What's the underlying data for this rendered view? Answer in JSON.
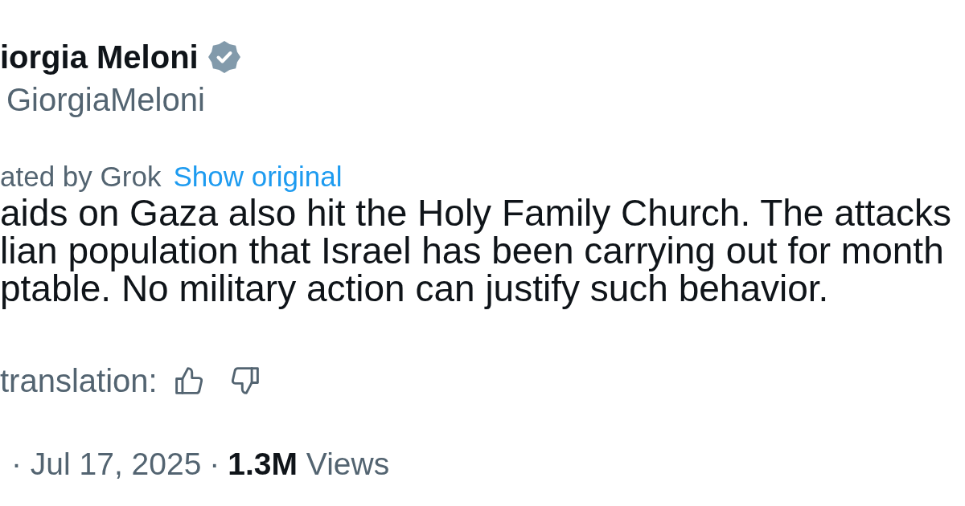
{
  "author": {
    "name": "iorgia Meloni",
    "verified": true,
    "handle": "GiorgiaMeloni"
  },
  "translation": {
    "label": "ated by Grok",
    "link": "Show original"
  },
  "body_lines": [
    "aids on Gaza also hit the Holy Family Church. The attacks",
    "lian population that Israel has been carrying out for month",
    "ptable. No military action can justify such behavior."
  ],
  "rate_translation": {
    "label": "translation:",
    "buttons": [
      {
        "kind": "thumbs_up"
      },
      {
        "kind": "thumbs_down"
      }
    ]
  },
  "meta": {
    "time": "· Jul 17, 2025",
    "separator": "·",
    "views": "**1.3M** Views"
  }
}
